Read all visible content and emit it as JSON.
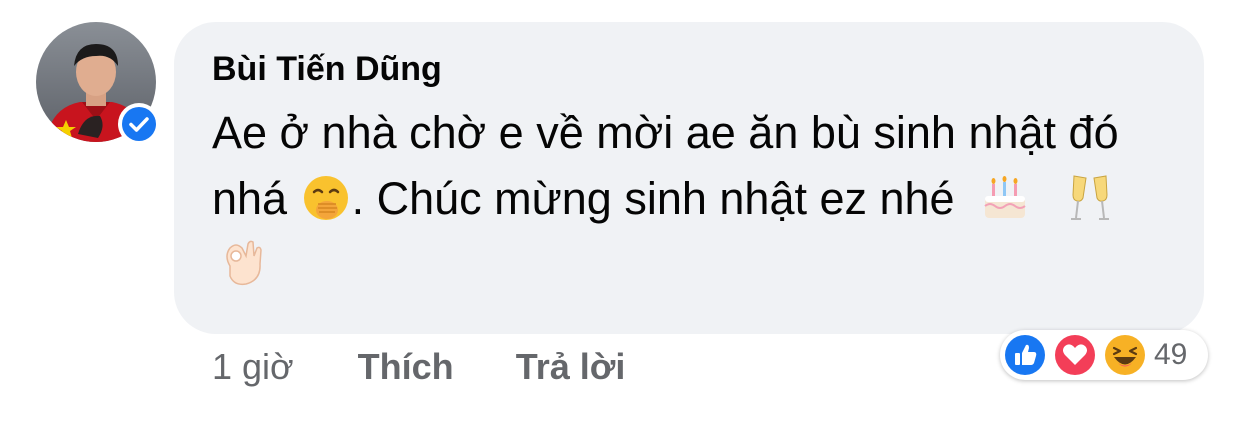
{
  "comment": {
    "author": "Bùi Tiến Dũng",
    "text_line1": "Ae ở nhà chờ e về mời ae ăn bù sinh nhật đó",
    "text_line2_start": "nhá",
    "text_line2_mid": ". Chúc mừng sinh nhật ez nhé",
    "emojis": [
      "face-with-hand-over-mouth",
      "birthday-cake",
      "clinking-glasses",
      "ok-hand"
    ],
    "verified": true
  },
  "meta": {
    "time": "1 giờ",
    "like_label": "Thích",
    "reply_label": "Trả lời"
  },
  "reactions": {
    "types": [
      "like",
      "love",
      "haha"
    ],
    "count": "49",
    "colors": {
      "like": "#1877f2",
      "love": "#f33e58",
      "haha": "#f7b125"
    }
  }
}
